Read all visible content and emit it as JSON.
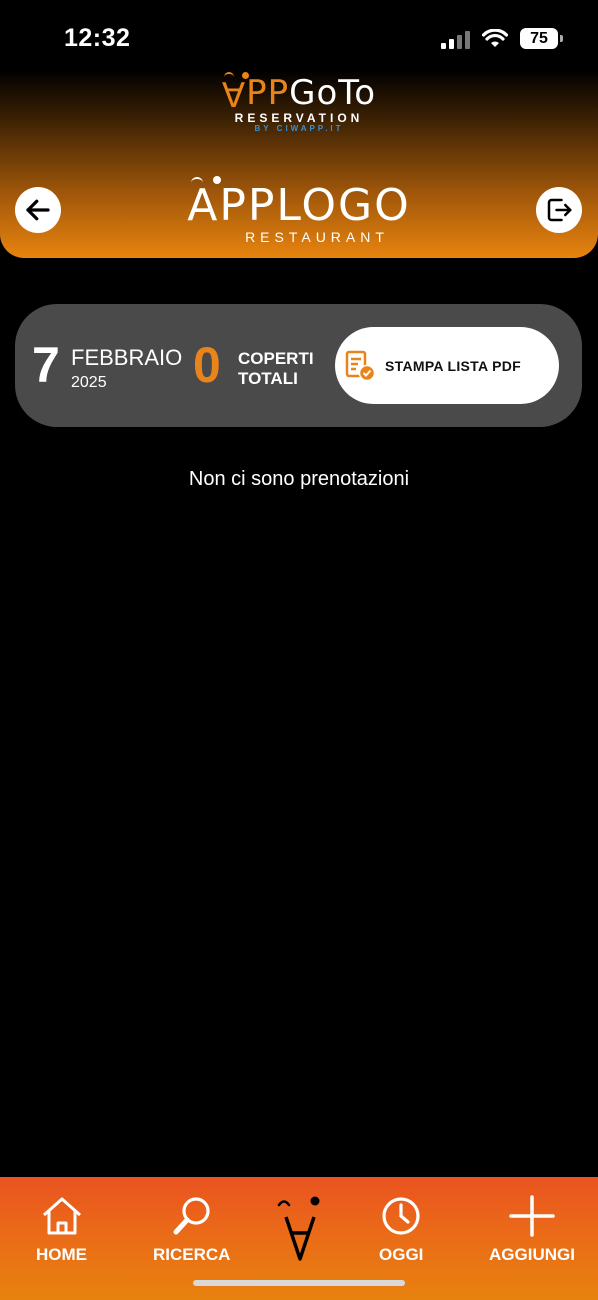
{
  "status_bar": {
    "time": "12:32",
    "battery": "75"
  },
  "header": {
    "brand": {
      "logo_a": "A",
      "logo_pp": "PP",
      "logo_go": "GoTo",
      "subtitle": "RESERVATION",
      "byline": "BY CIWAPP.IT"
    },
    "restaurant": {
      "logo": "APPLOGO",
      "subtitle": "RESTAURANT"
    },
    "back_icon": "arrow-left-icon",
    "logout_icon": "logout-icon"
  },
  "summary": {
    "day": "7",
    "month": "FEBBRAIO",
    "year": "2025",
    "covers_count": "0",
    "covers_label_line1": "COPERTI",
    "covers_label_line2": "TOTALI",
    "print_button_label": "STAMPA LISTA PDF",
    "accent_color": "#e8841a"
  },
  "empty_message": "Non ci sono prenotazioni",
  "bottom_nav": {
    "items": [
      {
        "label": "HOME",
        "icon": "home-icon"
      },
      {
        "label": "RICERCA",
        "icon": "search-icon"
      },
      {
        "label": "",
        "icon": "app-logo-icon"
      },
      {
        "label": "OGGI",
        "icon": "clock-icon"
      },
      {
        "label": "AGGIUNGI",
        "icon": "plus-icon"
      }
    ]
  }
}
